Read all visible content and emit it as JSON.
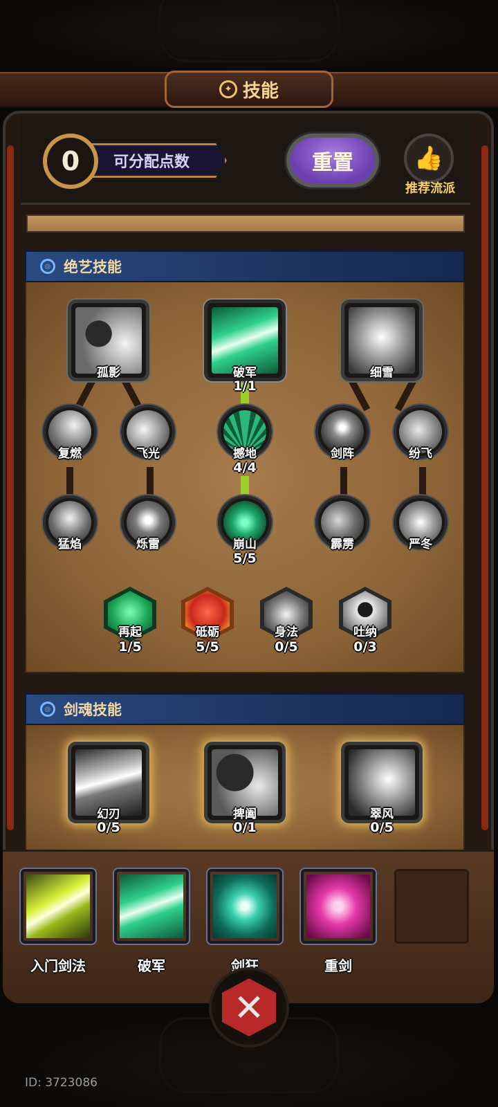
{
  "title": "技能",
  "header": {
    "points": "0",
    "points_label": "可分配点数",
    "reset_label": "重置",
    "recommend_label": "推荐流派"
  },
  "sections": {
    "ultimate": "绝艺技能",
    "soul": "剑魂技能"
  },
  "ultimate_tree": {
    "top": [
      {
        "name": "孤影",
        "count": ""
      },
      {
        "name": "破军",
        "count": "1/1"
      },
      {
        "name": "细雪",
        "count": ""
      }
    ],
    "row2": [
      {
        "name": "复燃",
        "count": ""
      },
      {
        "name": "飞光",
        "count": ""
      },
      {
        "name": "撼地",
        "count": "4/4"
      },
      {
        "name": "剑阵",
        "count": ""
      },
      {
        "name": "纷飞",
        "count": ""
      }
    ],
    "row3": [
      {
        "name": "猛焰",
        "count": ""
      },
      {
        "name": "烁雷",
        "count": ""
      },
      {
        "name": "崩山",
        "count": "5/5"
      },
      {
        "name": "霹雳",
        "count": ""
      },
      {
        "name": "严冬",
        "count": ""
      }
    ],
    "passives": [
      {
        "name": "再起",
        "count": "1/5"
      },
      {
        "name": "砥砺",
        "count": "5/5"
      },
      {
        "name": "身法",
        "count": "0/5"
      },
      {
        "name": "吐纳",
        "count": "0/3"
      }
    ]
  },
  "soul_skills": [
    {
      "name": "幻刃",
      "count": "0/5"
    },
    {
      "name": "捭阖",
      "count": "0/1"
    },
    {
      "name": "翠风",
      "count": "0/5"
    }
  ],
  "equipped": [
    {
      "name": "入门剑法"
    },
    {
      "name": "破军"
    },
    {
      "name": "剑狂"
    },
    {
      "name": "重剑"
    }
  ],
  "footer_id": "ID: 3723086",
  "colors": {
    "accent_gold": "#f7d58a",
    "active_link": "#9ccf2a",
    "reset_purple": "#8a5ccf",
    "section_blue": "#1d3460"
  }
}
